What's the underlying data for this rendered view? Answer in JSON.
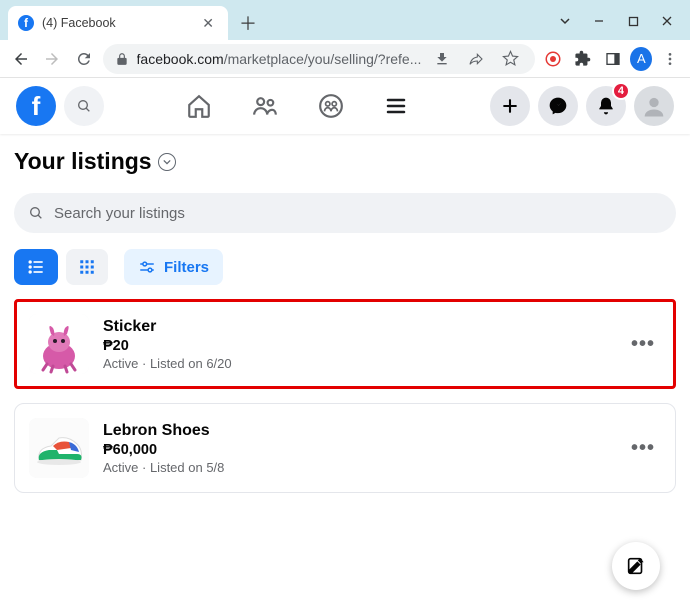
{
  "browser": {
    "tab_title": "(4) Facebook",
    "url_domain": "facebook.com",
    "url_path": "/marketplace/you/selling/?refe...",
    "avatar_letter": "A"
  },
  "header": {
    "notification_badge": "4"
  },
  "page": {
    "title": "Your listings",
    "search_placeholder": "Search your listings",
    "filters_label": "Filters"
  },
  "listings": [
    {
      "title": "Sticker",
      "price": "₱20",
      "status": "Active · Listed on 6/20",
      "highlighted": true
    },
    {
      "title": "Lebron Shoes",
      "price": "₱60,000",
      "status": "Active · Listed on 5/8",
      "highlighted": false
    }
  ]
}
